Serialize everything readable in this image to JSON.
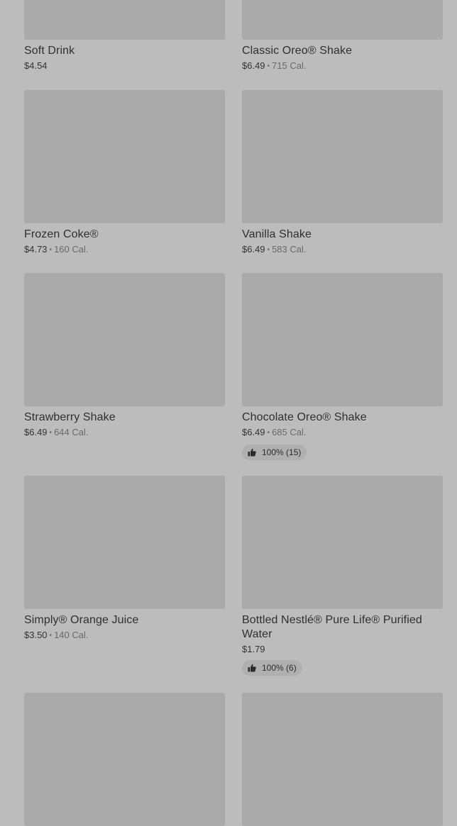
{
  "items": [
    {
      "name": "Soft Drink",
      "price": "$4.54",
      "calories": ""
    },
    {
      "name": "Classic Oreo® Shake",
      "price": "$6.49",
      "calories": "715 Cal."
    },
    {
      "name": "Frozen Coke®",
      "price": "$4.73",
      "calories": "160 Cal."
    },
    {
      "name": "Vanilla Shake",
      "price": "$6.49",
      "calories": "583 Cal."
    },
    {
      "name": "Strawberry Shake",
      "price": "$6.49",
      "calories": "644 Cal."
    },
    {
      "name": "Chocolate Oreo® Shake",
      "price": "$6.49",
      "calories": "685 Cal.",
      "rating": "100% (15)"
    },
    {
      "name": "Simply® Orange Juice",
      "price": "$3.50",
      "calories": "140 Cal."
    },
    {
      "name": "Bottled Nestlé® Pure Life® Purified Water",
      "price": "$1.79",
      "calories": "",
      "rating": "100% (6)"
    },
    {
      "name": "",
      "price": "",
      "calories": ""
    },
    {
      "name": "",
      "price": "",
      "calories": ""
    }
  ],
  "separator": "•",
  "icons": {
    "rating": "thumbs-up-icon"
  }
}
